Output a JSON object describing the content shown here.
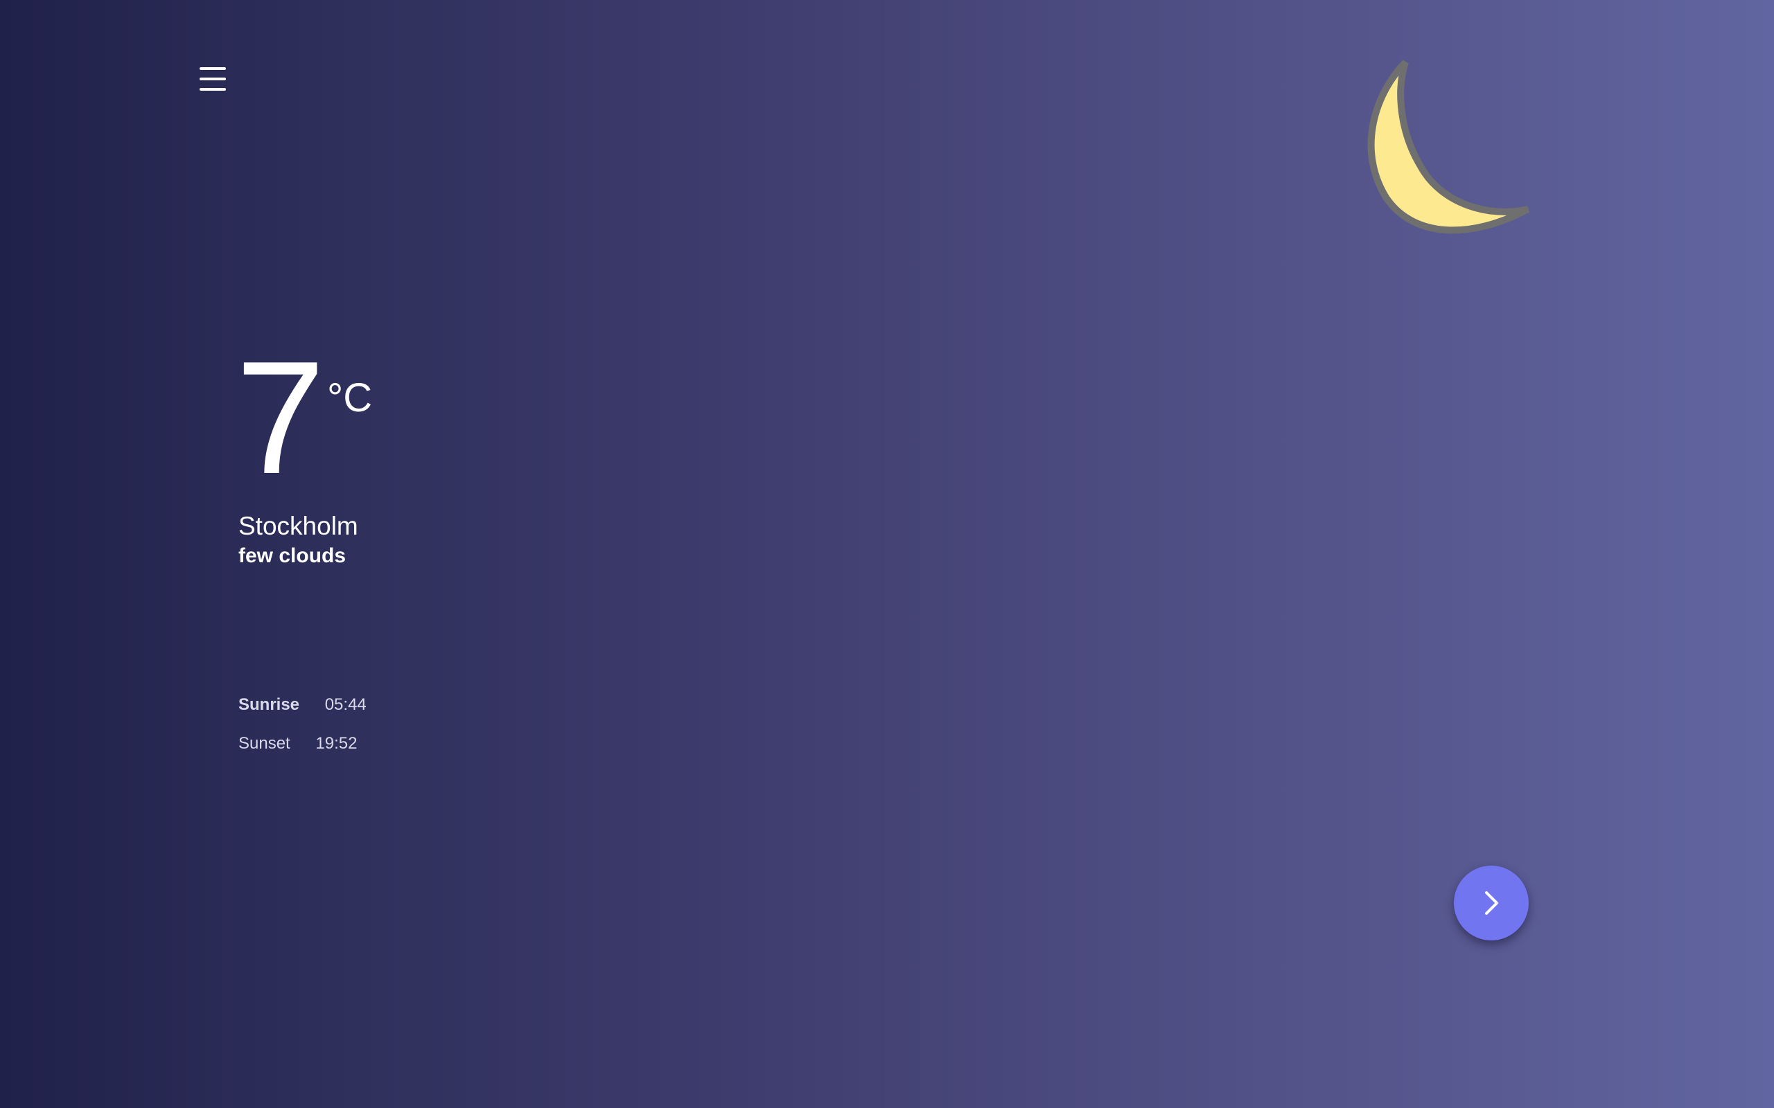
{
  "header": {
    "menu_icon": "hamburger-menu-icon"
  },
  "weather": {
    "icon": "crescent-moon-icon",
    "temperature": "7",
    "unit": "°C",
    "city": "Stockholm",
    "condition": "few clouds",
    "sunrise_label": "Sunrise",
    "sunrise_time": "05:44",
    "sunset_label": "Sunset",
    "sunset_time": "19:52"
  },
  "actions": {
    "next_icon": "chevron-right-icon"
  },
  "colors": {
    "background_start": "#20214a",
    "background_end": "#6165a0",
    "moon_fill": "#fde98f",
    "moon_outline": "#6f6f6f",
    "button": "#7175f0"
  }
}
